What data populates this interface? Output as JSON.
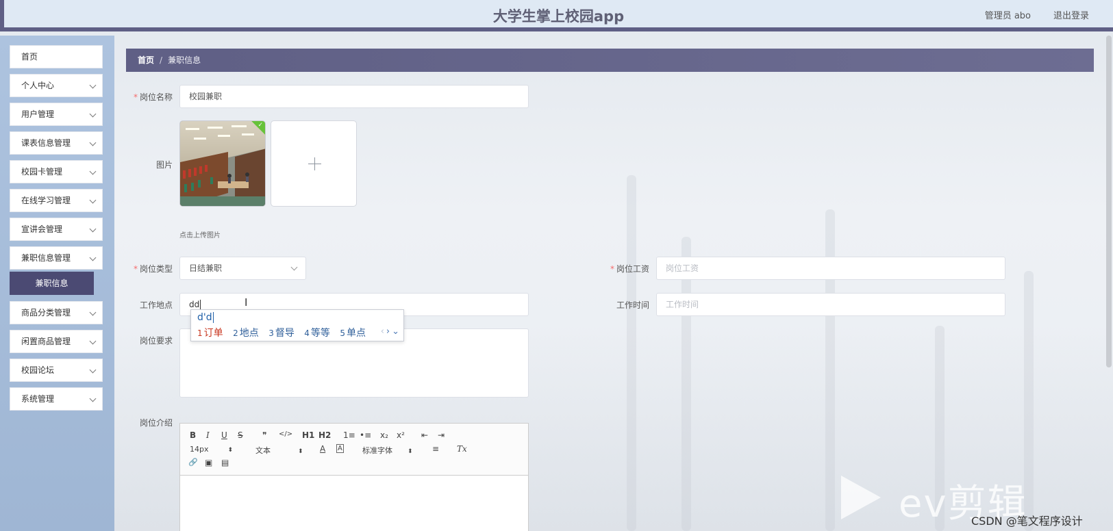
{
  "header": {
    "title": "大学生掌上校园app",
    "user": "管理员 abo",
    "logout": "退出登录"
  },
  "sidebar": {
    "items": [
      {
        "label": "首页",
        "has_children": false
      },
      {
        "label": "个人中心",
        "has_children": true
      },
      {
        "label": "用户管理",
        "has_children": true
      },
      {
        "label": "课表信息管理",
        "has_children": true
      },
      {
        "label": "校园卡管理",
        "has_children": true
      },
      {
        "label": "在线学习管理",
        "has_children": true
      },
      {
        "label": "宣讲会管理",
        "has_children": true
      },
      {
        "label": "兼职信息管理",
        "has_children": true
      },
      {
        "label": "商品分类管理",
        "has_children": true
      },
      {
        "label": "闲置商品管理",
        "has_children": true
      },
      {
        "label": "校园论坛",
        "has_children": true
      },
      {
        "label": "系统管理",
        "has_children": true
      }
    ],
    "active_sub": "兼职信息"
  },
  "breadcrumb": {
    "home": "首页",
    "separator": "/",
    "current": "兼职信息"
  },
  "form": {
    "position_name": {
      "label": "岗位名称",
      "value": "校园兼职",
      "required": true
    },
    "image": {
      "label": "图片",
      "tip": "点击上传图片"
    },
    "position_type": {
      "label": "岗位类型",
      "value": "日结兼职",
      "required": true
    },
    "salary": {
      "label": "岗位工资",
      "placeholder": "岗位工资",
      "required": true
    },
    "location": {
      "label": "工作地点",
      "value": "dd"
    },
    "work_time": {
      "label": "工作时间",
      "placeholder": "工作时间"
    },
    "requirements": {
      "label": "岗位要求"
    },
    "intro": {
      "label": "岗位介绍"
    }
  },
  "ime": {
    "composition": "d'd",
    "candidates": [
      {
        "num": "1",
        "text": "订单"
      },
      {
        "num": "2",
        "text": "地点"
      },
      {
        "num": "3",
        "text": "督导"
      },
      {
        "num": "4",
        "text": "等等"
      },
      {
        "num": "5",
        "text": "单点"
      }
    ],
    "prev": "‹",
    "next": "›",
    "expand": "⌄"
  },
  "editor": {
    "font_size": "14px",
    "text_type": "文本",
    "font_family": "标准字体",
    "buttons": {
      "bold": "B",
      "italic": "I",
      "underline": "U",
      "strike": "S",
      "quote": "❞",
      "code": "</>",
      "h1": "H1",
      "h2": "H2",
      "ordered": "1≡",
      "bullet": "•≡",
      "sub": "x₂",
      "sup": "x²",
      "outdent": "⇤",
      "indent": "⇥",
      "color": "A",
      "background": "A",
      "align": "≡",
      "clean": "Tx",
      "link": "🔗",
      "image": "▣",
      "video": "▤"
    },
    "select_arrow": "⬍"
  },
  "watermark": {
    "brand": "ev剪辑",
    "csdn": "CSDN @笔文程序设计"
  },
  "cursor": "I",
  "colors": {
    "primary": "#5f5f85",
    "sidebar_bg": "#a8bedb",
    "active_sub": "#4b4a73",
    "required": "#f56c6c"
  }
}
